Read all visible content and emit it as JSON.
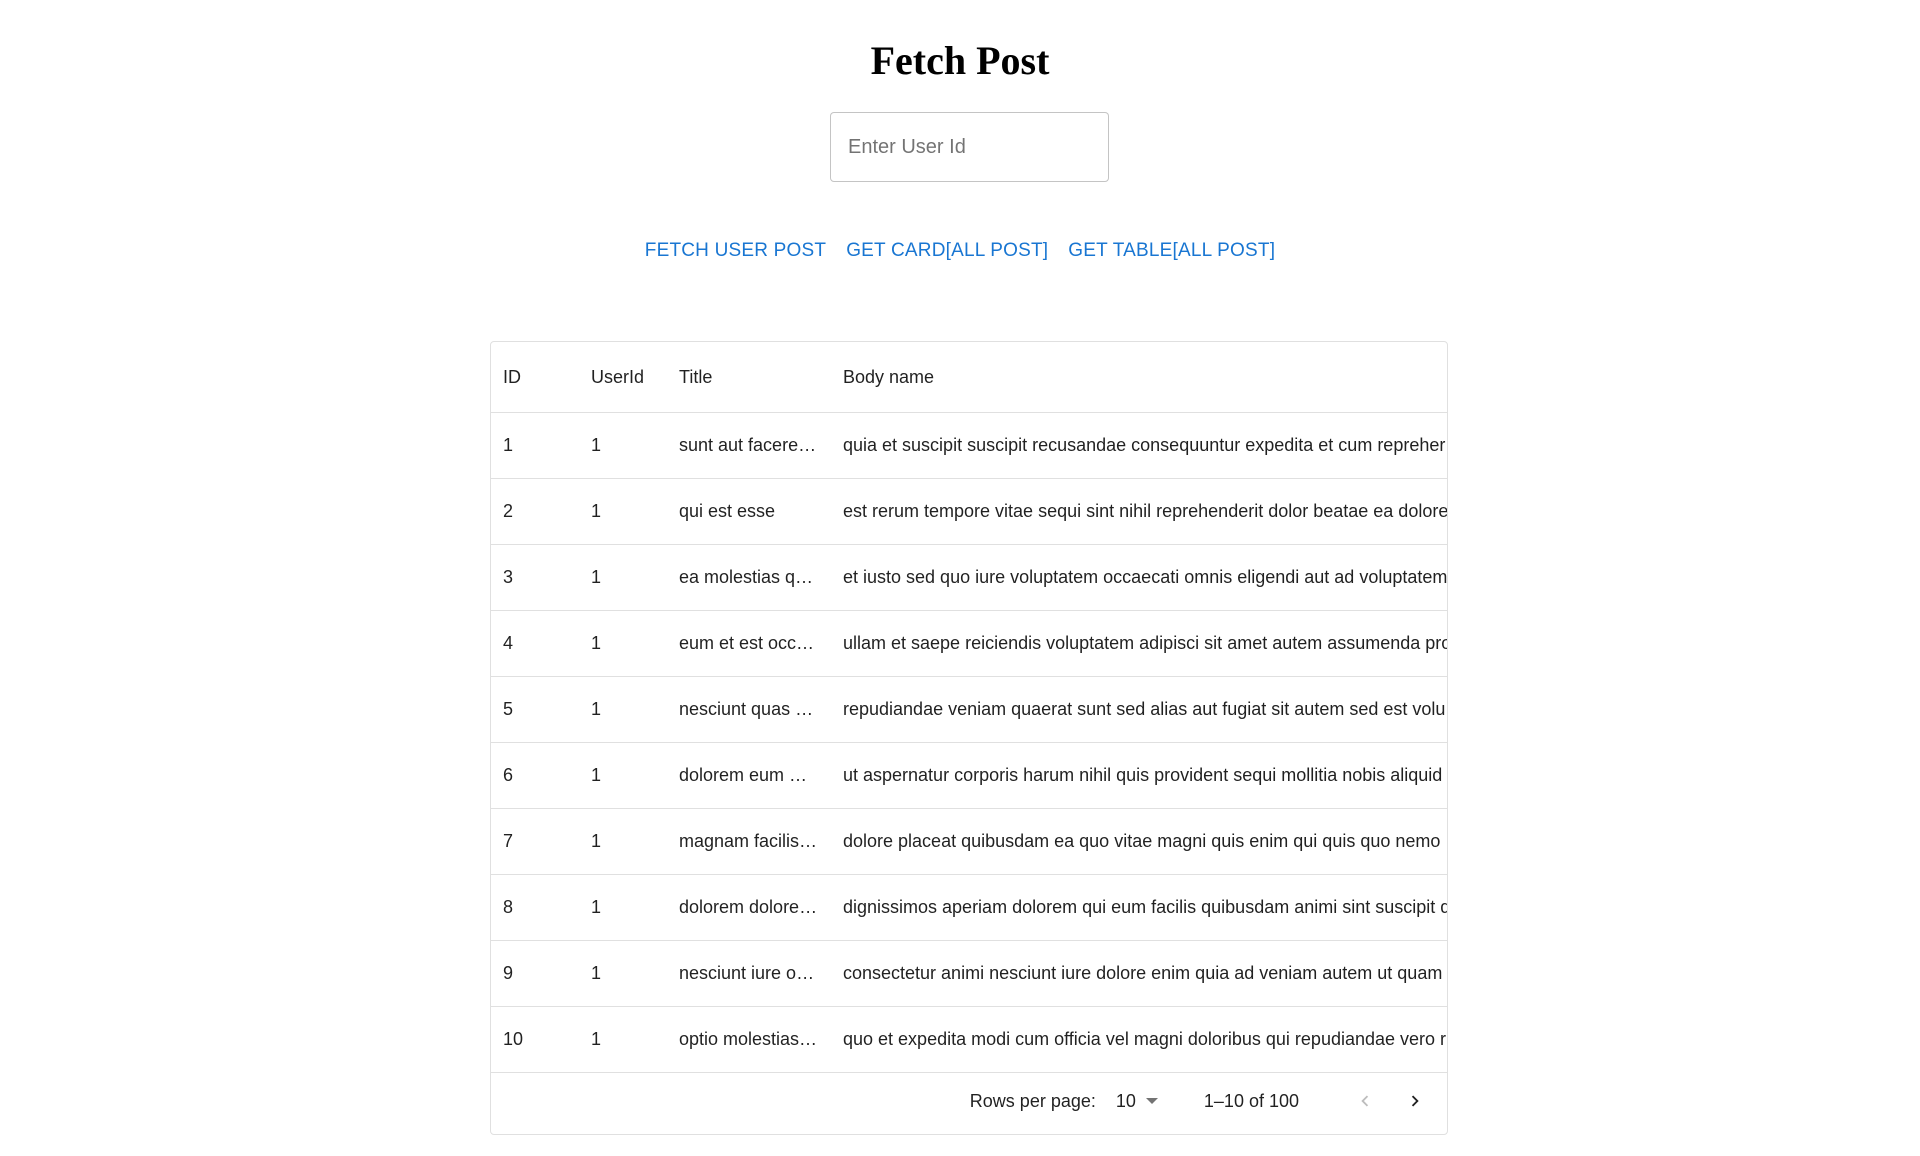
{
  "page": {
    "title": "Fetch Post"
  },
  "input": {
    "placeholder": "Enter User Id"
  },
  "actions": {
    "fetch_user_post": "FETCH USER POST",
    "get_card": "GET CARD[ALL POST]",
    "get_table": "GET TABLE[ALL POST]"
  },
  "table": {
    "columns": [
      "ID",
      "UserId",
      "Title",
      "Body name"
    ],
    "rows": [
      {
        "id": "1",
        "userId": "1",
        "title": "sunt aut facere…",
        "body": "quia et suscipit suscipit recusandae consequuntur expedita et cum repreher"
      },
      {
        "id": "2",
        "userId": "1",
        "title": "qui est esse",
        "body": "est rerum tempore vitae sequi sint nihil reprehenderit dolor beatae ea dolore"
      },
      {
        "id": "3",
        "userId": "1",
        "title": "ea molestias q…",
        "body": "et iusto sed quo iure voluptatem occaecati omnis eligendi aut ad voluptatem"
      },
      {
        "id": "4",
        "userId": "1",
        "title": "eum et est occ…",
        "body": "ullam et saepe reiciendis voluptatem adipisci sit amet autem assumenda pro"
      },
      {
        "id": "5",
        "userId": "1",
        "title": "nesciunt quas …",
        "body": "repudiandae veniam quaerat sunt sed alias aut fugiat sit autem sed est volu"
      },
      {
        "id": "6",
        "userId": "1",
        "title": "dolorem eum …",
        "body": "ut aspernatur corporis harum nihil quis provident sequi mollitia nobis aliquid"
      },
      {
        "id": "7",
        "userId": "1",
        "title": "magnam facilis…",
        "body": "dolore placeat quibusdam ea quo vitae magni quis enim qui quis quo nemo"
      },
      {
        "id": "8",
        "userId": "1",
        "title": "dolorem dolore…",
        "body": "dignissimos aperiam dolorem qui eum facilis quibusdam animi sint suscipit q"
      },
      {
        "id": "9",
        "userId": "1",
        "title": "nesciunt iure o…",
        "body": "consectetur animi nesciunt iure dolore enim quia ad veniam autem ut quam"
      },
      {
        "id": "10",
        "userId": "1",
        "title": "optio molestias…",
        "body": "quo et expedita modi cum officia vel magni doloribus qui repudiandae vero r"
      }
    ]
  },
  "pagination": {
    "rows_per_page_label": "Rows per page:",
    "rows_per_page_value": "10",
    "range": "1–10 of 100",
    "prev_icon": "chevron-left-icon",
    "next_icon": "chevron-right-icon"
  },
  "colors": {
    "accent": "#1976d2",
    "border": "#e0e0e0"
  }
}
